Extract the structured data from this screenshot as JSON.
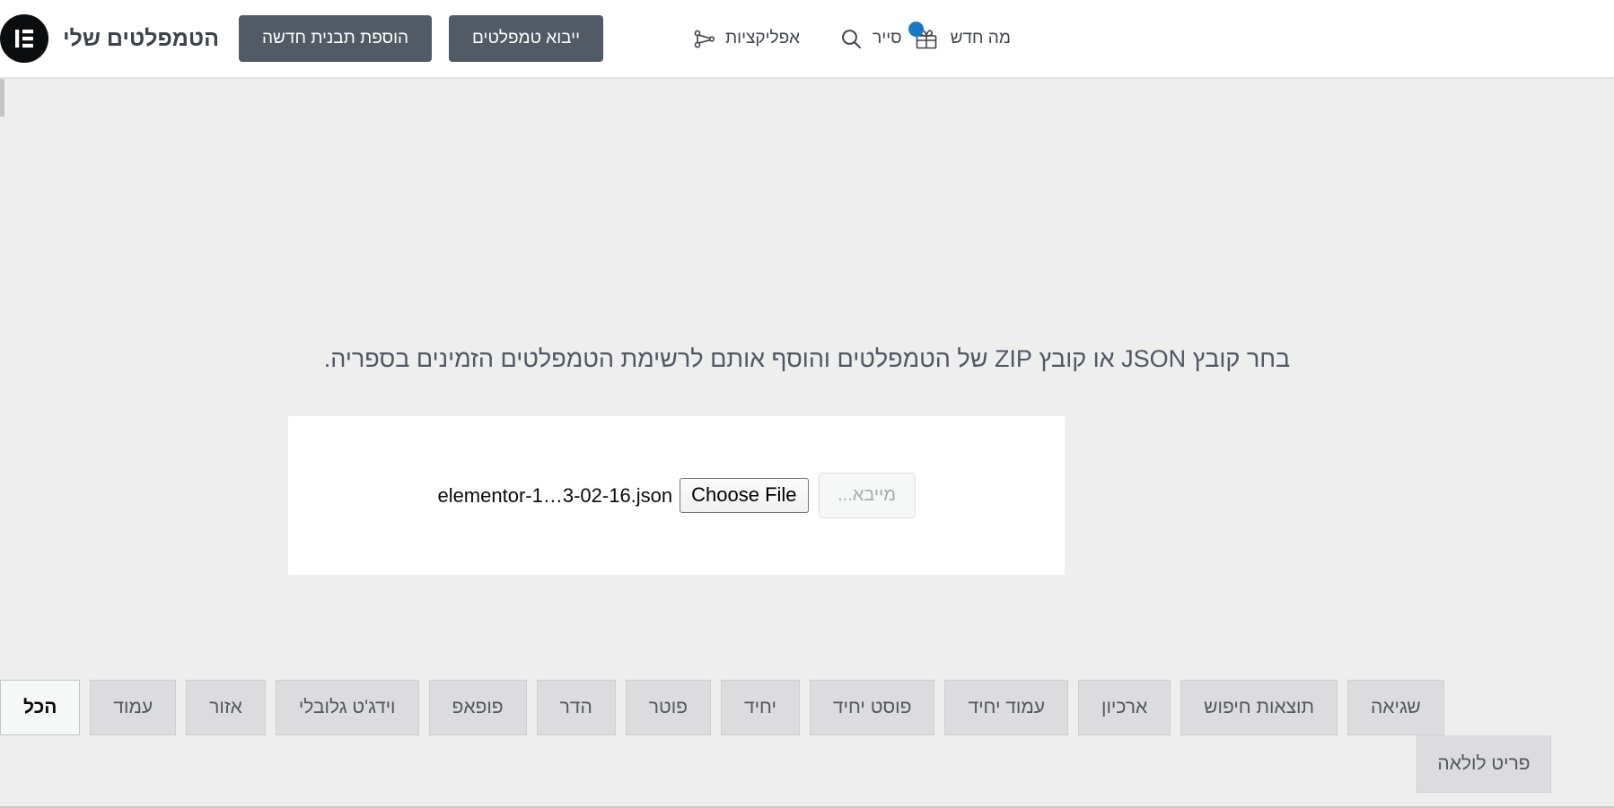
{
  "topbar": {
    "brand_title": "הטמפלטים שלי",
    "brand_logo_icon": "elementor-logo-icon",
    "actions": [
      {
        "label": "הוספת תבנית חדשה",
        "name": "add-new-template-button"
      },
      {
        "label": "ייבוא טמפלטים",
        "name": "import-templates-button"
      }
    ],
    "nav": [
      {
        "label": "אפליקציות",
        "icon": "apps-network-icon",
        "name": "nav-item-apps"
      },
      {
        "label": "סייר",
        "icon": "search-icon",
        "name": "nav-item-finder"
      },
      {
        "label": "מה חדש",
        "icon": "gift-icon",
        "badge": true,
        "name": "nav-item-whats-new"
      }
    ]
  },
  "main": {
    "import_lead": "בחר קובץ JSON או קובץ ZIP של הטמפלטים והוסף אותם לרשימת הטמפלטים הזמינים בספריה.",
    "upload": {
      "choose_file_label": "Choose File",
      "file_name": "elementor-1…3-02-16.json",
      "submit_label": "מייבא..."
    }
  },
  "tabs": [
    {
      "label": "הכל",
      "active": true,
      "name": "tab-all"
    },
    {
      "label": "עמוד",
      "active": false,
      "name": "tab-page"
    },
    {
      "label": "אזור",
      "active": false,
      "name": "tab-section"
    },
    {
      "label": "וידג'ט גלובלי",
      "active": false,
      "name": "tab-global-widget"
    },
    {
      "label": "פופאפ",
      "active": false,
      "name": "tab-popup"
    },
    {
      "label": "הדר",
      "active": false,
      "name": "tab-header"
    },
    {
      "label": "פוטר",
      "active": false,
      "name": "tab-footer"
    },
    {
      "label": "יחיד",
      "active": false,
      "name": "tab-single"
    },
    {
      "label": "פוסט יחיד",
      "active": false,
      "name": "tab-single-post"
    },
    {
      "label": "עמוד יחיד",
      "active": false,
      "name": "tab-single-page"
    },
    {
      "label": "ארכיון",
      "active": false,
      "name": "tab-archive"
    },
    {
      "label": "תוצאות חיפוש",
      "active": false,
      "name": "tab-search-results"
    },
    {
      "label": "שגיאה",
      "active": false,
      "name": "tab-error"
    }
  ],
  "dropdown": {
    "item_label": "פריט לולאה"
  },
  "colors": {
    "topbar_bg": "#ffffff",
    "page_bg": "#eeeeee",
    "button_primary": "#525a65",
    "accent_badge": "#1978c4",
    "tab_bg": "#dcdcde",
    "tab_active_bg": "#f6f7f7",
    "text_primary": "#3f444b",
    "text_muted": "#50575e"
  }
}
